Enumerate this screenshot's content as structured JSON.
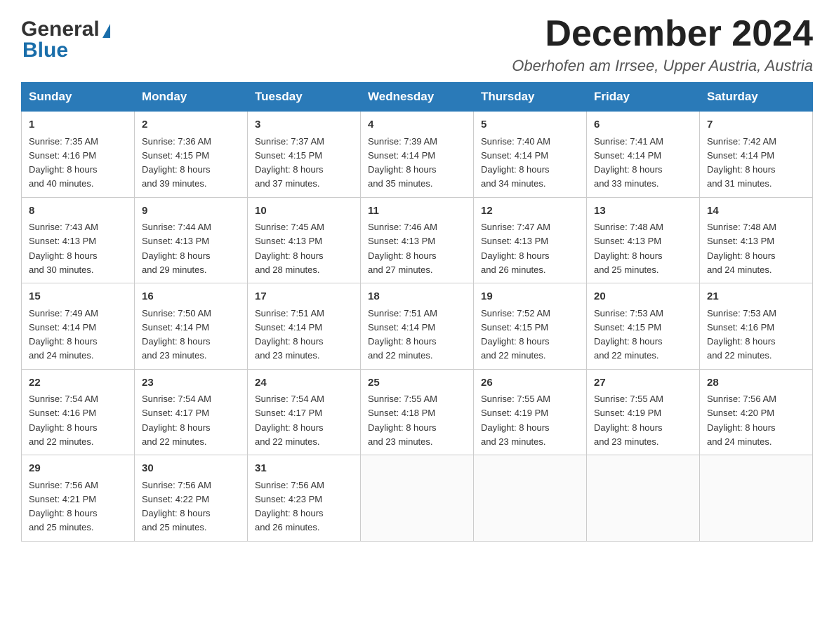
{
  "logo": {
    "general": "General",
    "blue": "Blue",
    "triangle": "▶"
  },
  "header": {
    "month_year": "December 2024",
    "location": "Oberhofen am Irrsee, Upper Austria, Austria"
  },
  "weekdays": [
    "Sunday",
    "Monday",
    "Tuesday",
    "Wednesday",
    "Thursday",
    "Friday",
    "Saturday"
  ],
  "weeks": [
    [
      {
        "day": "1",
        "sunrise": "7:35 AM",
        "sunset": "4:16 PM",
        "daylight": "8 hours and 40 minutes."
      },
      {
        "day": "2",
        "sunrise": "7:36 AM",
        "sunset": "4:15 PM",
        "daylight": "8 hours and 39 minutes."
      },
      {
        "day": "3",
        "sunrise": "7:37 AM",
        "sunset": "4:15 PM",
        "daylight": "8 hours and 37 minutes."
      },
      {
        "day": "4",
        "sunrise": "7:39 AM",
        "sunset": "4:14 PM",
        "daylight": "8 hours and 35 minutes."
      },
      {
        "day": "5",
        "sunrise": "7:40 AM",
        "sunset": "4:14 PM",
        "daylight": "8 hours and 34 minutes."
      },
      {
        "day": "6",
        "sunrise": "7:41 AM",
        "sunset": "4:14 PM",
        "daylight": "8 hours and 33 minutes."
      },
      {
        "day": "7",
        "sunrise": "7:42 AM",
        "sunset": "4:14 PM",
        "daylight": "8 hours and 31 minutes."
      }
    ],
    [
      {
        "day": "8",
        "sunrise": "7:43 AM",
        "sunset": "4:13 PM",
        "daylight": "8 hours and 30 minutes."
      },
      {
        "day": "9",
        "sunrise": "7:44 AM",
        "sunset": "4:13 PM",
        "daylight": "8 hours and 29 minutes."
      },
      {
        "day": "10",
        "sunrise": "7:45 AM",
        "sunset": "4:13 PM",
        "daylight": "8 hours and 28 minutes."
      },
      {
        "day": "11",
        "sunrise": "7:46 AM",
        "sunset": "4:13 PM",
        "daylight": "8 hours and 27 minutes."
      },
      {
        "day": "12",
        "sunrise": "7:47 AM",
        "sunset": "4:13 PM",
        "daylight": "8 hours and 26 minutes."
      },
      {
        "day": "13",
        "sunrise": "7:48 AM",
        "sunset": "4:13 PM",
        "daylight": "8 hours and 25 minutes."
      },
      {
        "day": "14",
        "sunrise": "7:48 AM",
        "sunset": "4:13 PM",
        "daylight": "8 hours and 24 minutes."
      }
    ],
    [
      {
        "day": "15",
        "sunrise": "7:49 AM",
        "sunset": "4:14 PM",
        "daylight": "8 hours and 24 minutes."
      },
      {
        "day": "16",
        "sunrise": "7:50 AM",
        "sunset": "4:14 PM",
        "daylight": "8 hours and 23 minutes."
      },
      {
        "day": "17",
        "sunrise": "7:51 AM",
        "sunset": "4:14 PM",
        "daylight": "8 hours and 23 minutes."
      },
      {
        "day": "18",
        "sunrise": "7:51 AM",
        "sunset": "4:14 PM",
        "daylight": "8 hours and 22 minutes."
      },
      {
        "day": "19",
        "sunrise": "7:52 AM",
        "sunset": "4:15 PM",
        "daylight": "8 hours and 22 minutes."
      },
      {
        "day": "20",
        "sunrise": "7:53 AM",
        "sunset": "4:15 PM",
        "daylight": "8 hours and 22 minutes."
      },
      {
        "day": "21",
        "sunrise": "7:53 AM",
        "sunset": "4:16 PM",
        "daylight": "8 hours and 22 minutes."
      }
    ],
    [
      {
        "day": "22",
        "sunrise": "7:54 AM",
        "sunset": "4:16 PM",
        "daylight": "8 hours and 22 minutes."
      },
      {
        "day": "23",
        "sunrise": "7:54 AM",
        "sunset": "4:17 PM",
        "daylight": "8 hours and 22 minutes."
      },
      {
        "day": "24",
        "sunrise": "7:54 AM",
        "sunset": "4:17 PM",
        "daylight": "8 hours and 22 minutes."
      },
      {
        "day": "25",
        "sunrise": "7:55 AM",
        "sunset": "4:18 PM",
        "daylight": "8 hours and 23 minutes."
      },
      {
        "day": "26",
        "sunrise": "7:55 AM",
        "sunset": "4:19 PM",
        "daylight": "8 hours and 23 minutes."
      },
      {
        "day": "27",
        "sunrise": "7:55 AM",
        "sunset": "4:19 PM",
        "daylight": "8 hours and 23 minutes."
      },
      {
        "day": "28",
        "sunrise": "7:56 AM",
        "sunset": "4:20 PM",
        "daylight": "8 hours and 24 minutes."
      }
    ],
    [
      {
        "day": "29",
        "sunrise": "7:56 AM",
        "sunset": "4:21 PM",
        "daylight": "8 hours and 25 minutes."
      },
      {
        "day": "30",
        "sunrise": "7:56 AM",
        "sunset": "4:22 PM",
        "daylight": "8 hours and 25 minutes."
      },
      {
        "day": "31",
        "sunrise": "7:56 AM",
        "sunset": "4:23 PM",
        "daylight": "8 hours and 26 minutes."
      },
      null,
      null,
      null,
      null
    ]
  ],
  "labels": {
    "sunrise": "Sunrise: ",
    "sunset": "Sunset: ",
    "daylight": "Daylight: "
  }
}
